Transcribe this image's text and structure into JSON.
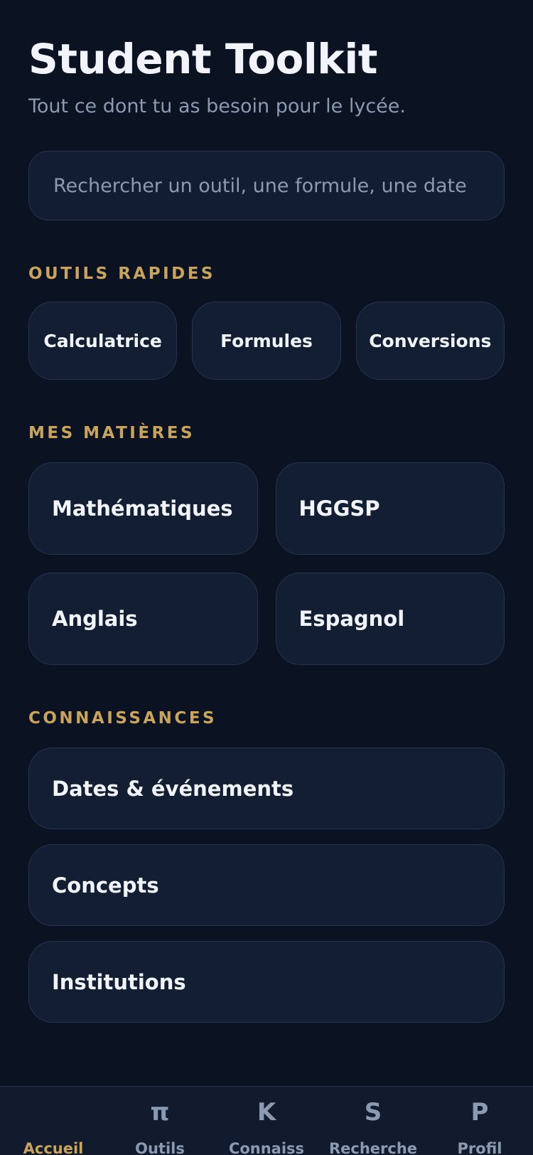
{
  "header": {
    "title": "Student Toolkit",
    "subtitle": "Tout ce dont tu as besoin pour le lycée."
  },
  "search": {
    "placeholder": "Rechercher un outil, une formule, une date",
    "value": ""
  },
  "quick_tools": {
    "label": "OUTILS RAPIDES",
    "items": [
      "Calculatrice",
      "Formules",
      "Conversions"
    ]
  },
  "subjects": {
    "label": "MES MATIÈRES",
    "items": [
      "Mathématiques",
      "HGGSP",
      "Anglais",
      "Espagnol"
    ]
  },
  "knowledge": {
    "label": "CONNAISSANCES",
    "items": [
      "Dates & événements",
      "Concepts",
      "Institutions"
    ]
  },
  "tabbar": {
    "items": [
      {
        "glyph": "",
        "label": "Accueil",
        "active": true
      },
      {
        "glyph": "π",
        "label": "Outils",
        "active": false
      },
      {
        "glyph": "K",
        "label": "Connaiss",
        "active": false
      },
      {
        "glyph": "S",
        "label": "Recherche",
        "active": false
      },
      {
        "glyph": "P",
        "label": "Profil",
        "active": false
      }
    ]
  },
  "colors": {
    "background": "#0b1221",
    "card": "#131e33",
    "border": "#243451",
    "accent": "#c9a55c",
    "text": "#f1f5fb",
    "muted": "#8c9ab1"
  }
}
